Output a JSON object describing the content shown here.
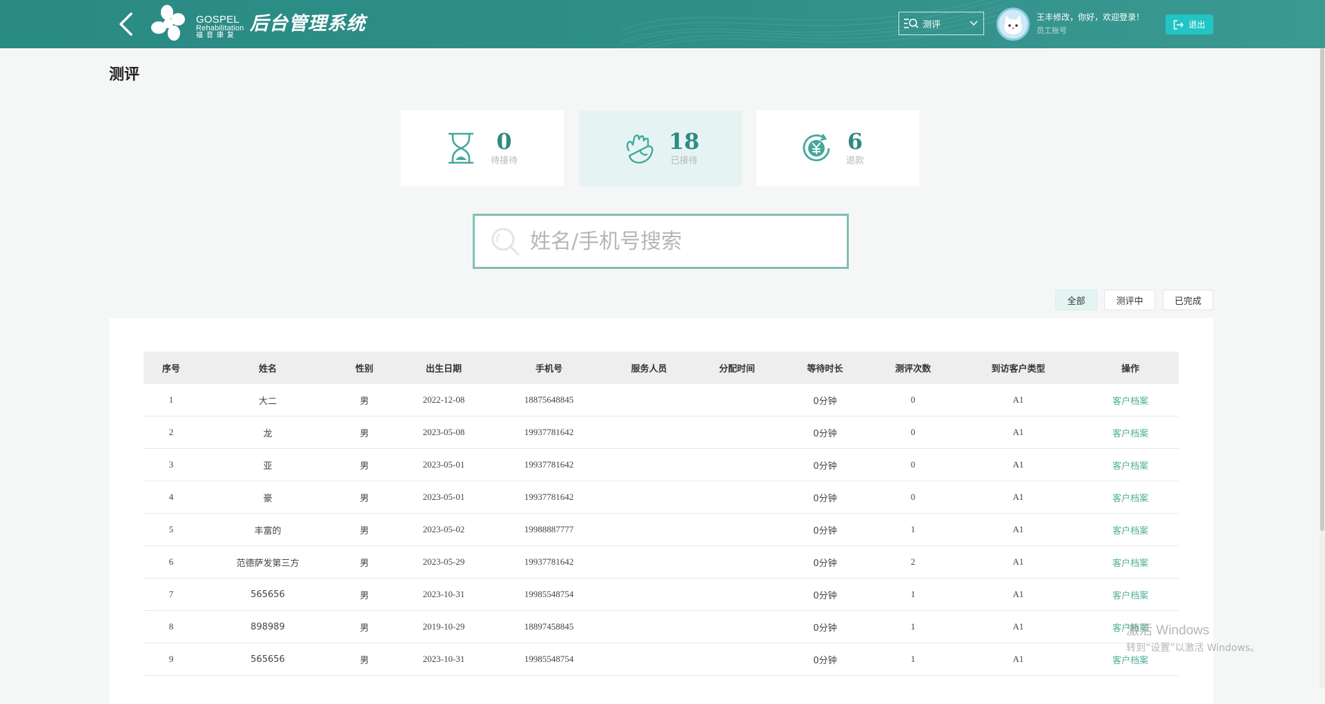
{
  "header": {
    "logo_en_1": "GOSPEL",
    "logo_en_2": "Rehabilitation",
    "logo_cn": "福音康复",
    "system_title": "后台管理系统",
    "module_select": "测评",
    "greeting": "王丰修改，你好，欢迎登录！",
    "role": "员工账号",
    "logout_label": "退出",
    "accent_color": "#2f8f88",
    "logout_color": "#22c4c4",
    "icons": [
      "back-arrow-icon",
      "search-list-icon",
      "chevron-down-icon",
      "avatar-cat-icon",
      "logout-icon"
    ]
  },
  "page": {
    "title": "测评"
  },
  "stats": [
    {
      "value": "0",
      "label": "待接待",
      "icon": "hourglass-icon"
    },
    {
      "value": "18",
      "label": "已接待",
      "icon": "hand-icon"
    },
    {
      "value": "6",
      "label": "退款",
      "icon": "refund-yen-icon"
    }
  ],
  "search": {
    "placeholder": "姓名/手机号搜索"
  },
  "filters": [
    "全部",
    "测评中",
    "已完成"
  ],
  "table": {
    "columns": [
      "序号",
      "姓名",
      "性别",
      "出生日期",
      "手机号",
      "服务人员",
      "分配时间",
      "等待时长",
      "测评次数",
      "到访客户类型",
      "操作"
    ],
    "rows": [
      [
        "1",
        "大二",
        "男",
        "2022-12-08",
        "18875648845",
        "",
        "",
        "0分钟",
        "0",
        "A1",
        "客户档案"
      ],
      [
        "2",
        "龙",
        "男",
        "2023-05-08",
        "19937781642",
        "",
        "",
        "0分钟",
        "0",
        "A1",
        "客户档案"
      ],
      [
        "3",
        "亚",
        "男",
        "2023-05-01",
        "19937781642",
        "",
        "",
        "0分钟",
        "0",
        "A1",
        "客户档案"
      ],
      [
        "4",
        "豪",
        "男",
        "2023-05-01",
        "19937781642",
        "",
        "",
        "0分钟",
        "0",
        "A1",
        "客户档案"
      ],
      [
        "5",
        "丰富的",
        "男",
        "2023-05-02",
        "19988887777",
        "",
        "",
        "0分钟",
        "1",
        "A1",
        "客户档案"
      ],
      [
        "6",
        "范德萨发第三方",
        "男",
        "2023-05-29",
        "19937781642",
        "",
        "",
        "0分钟",
        "2",
        "A1",
        "客户档案"
      ],
      [
        "7",
        "565656",
        "男",
        "2023-10-31",
        "19985548754",
        "",
        "",
        "0分钟",
        "1",
        "A1",
        "客户档案"
      ],
      [
        "8",
        "898989",
        "男",
        "2019-10-29",
        "18897458845",
        "",
        "",
        "0分钟",
        "1",
        "A1",
        "客户档案"
      ],
      [
        "9",
        "565656",
        "男",
        "2023-10-31",
        "19985548754",
        "",
        "",
        "0分钟",
        "1",
        "A1",
        "客户档案"
      ]
    ]
  },
  "watermark": {
    "line1": "激活 Windows",
    "line2": "转到“设置”以激活 Windows。"
  }
}
